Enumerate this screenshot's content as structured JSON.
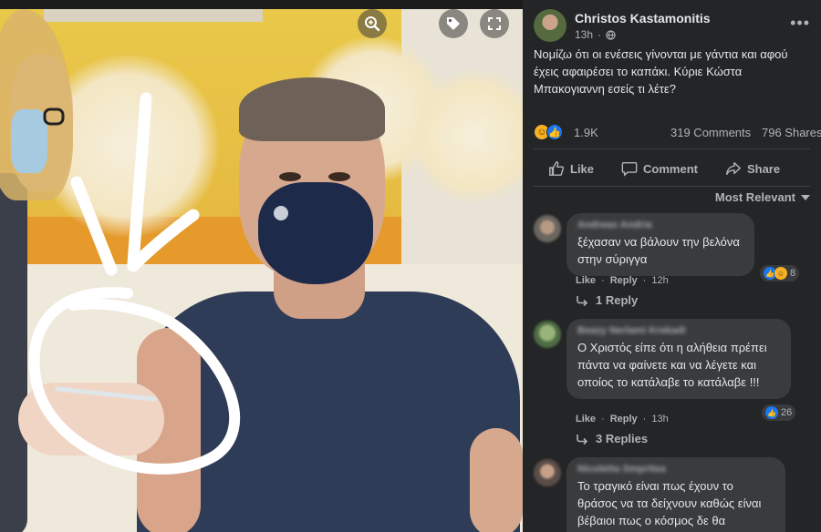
{
  "post": {
    "author": "Christos Kastamonitis",
    "time": "13h",
    "audience_icon": "globe-icon",
    "text": "Νομίζω ότι οι ενέσεις γίνονται με γάντια και αφού έχεις αφαιρέσει το καπάκι. Κύριε Κώστα Μπακογιαννη εσείς τι λέτε?",
    "reaction_count": "1.9K",
    "comments_count": "319 Comments",
    "shares_count": "796 Shares"
  },
  "actions": {
    "like": "Like",
    "comment": "Comment",
    "share": "Share"
  },
  "sort": {
    "label": "Most Relevant"
  },
  "comments": [
    {
      "name": "Andreas Andria",
      "text": "ξέχασαν να βάλουν την βελόνα στην σύριγγα",
      "like": "Like",
      "reply": "Reply",
      "time": "12h",
      "reactions": "8",
      "replies": "1 Reply"
    },
    {
      "name": "Beazy Nerlami Krekadi",
      "text": "Ο Χριστός είπε ότι η αλήθεια πρέπει πάντα να φαίνετε και να λέγετε και οποίος το κατάλαβε το κατάλαβε !!!",
      "like": "Like",
      "reply": "Reply",
      "time": "13h",
      "reactions": "26",
      "replies": "3 Replies"
    },
    {
      "name": "Nicoletta Smpritea",
      "text": "Το τραγικό είναι πως έχουν το θράσος να τα δείχνουν καθώς είναι βέβαιοι πως ο κόσμος δε θα"
    }
  ],
  "colors": {
    "panel_bg": "#242526",
    "bubble_bg": "#3a3b3c",
    "text_primary": "#e4e6eb",
    "text_secondary": "#b0b3b8",
    "like_blue": "#1877f2",
    "haha_yellow": "#f7b125",
    "annotation_white": "#ffffff"
  },
  "icons": {
    "zoom": "zoom-in-icon",
    "tag": "tag-icon",
    "fullscreen": "expand-icon",
    "more": "more-horizontal-icon",
    "sort": "chevron-down-icon",
    "reply_arrow": "reply-arrow-icon"
  }
}
